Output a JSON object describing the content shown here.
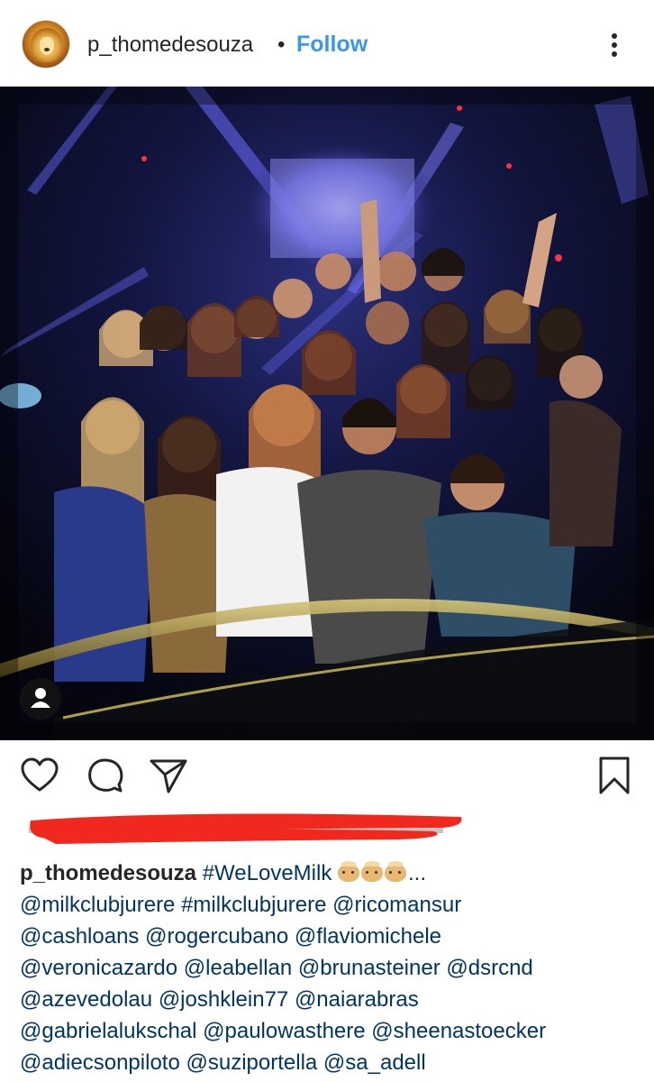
{
  "post": {
    "username": "p_thomedesouza",
    "separator": "•",
    "follow_label": "Follow",
    "icons": {
      "more": "more-vertical-icon",
      "tag": "user-tag-icon",
      "like": "heart-icon",
      "comment": "comment-icon",
      "share": "paper-plane-icon",
      "save": "bookmark-icon"
    }
  },
  "caption": {
    "username": "p_thomedesouza",
    "hashtag": "#WeLoveMilk",
    "ellipsis": "...",
    "emoji_names": [
      "cow-face-emoji",
      "cow-face-emoji",
      "cow-face-emoji"
    ],
    "lines": [
      [
        "@milkclubjurere",
        "#milkclubjurere",
        "@ricomansur"
      ],
      [
        "@cashloans",
        "@rogercubano",
        "@flaviomichele"
      ],
      [
        "@veronicazardo",
        "@leabellan",
        "@brunasteiner",
        "@dsrcnd"
      ],
      [
        "@azevedolau",
        "@joshklein77",
        "@naiarabras"
      ],
      [
        "@gabrielalukschal",
        "@paulowasthere",
        "@sheenastoecker"
      ],
      [
        "@adiecsonpiloto",
        "@suziportella",
        "@sa_adell"
      ]
    ]
  },
  "colors": {
    "link": "#003569",
    "follow": "#3897f0",
    "redaction": "#f0281e"
  }
}
